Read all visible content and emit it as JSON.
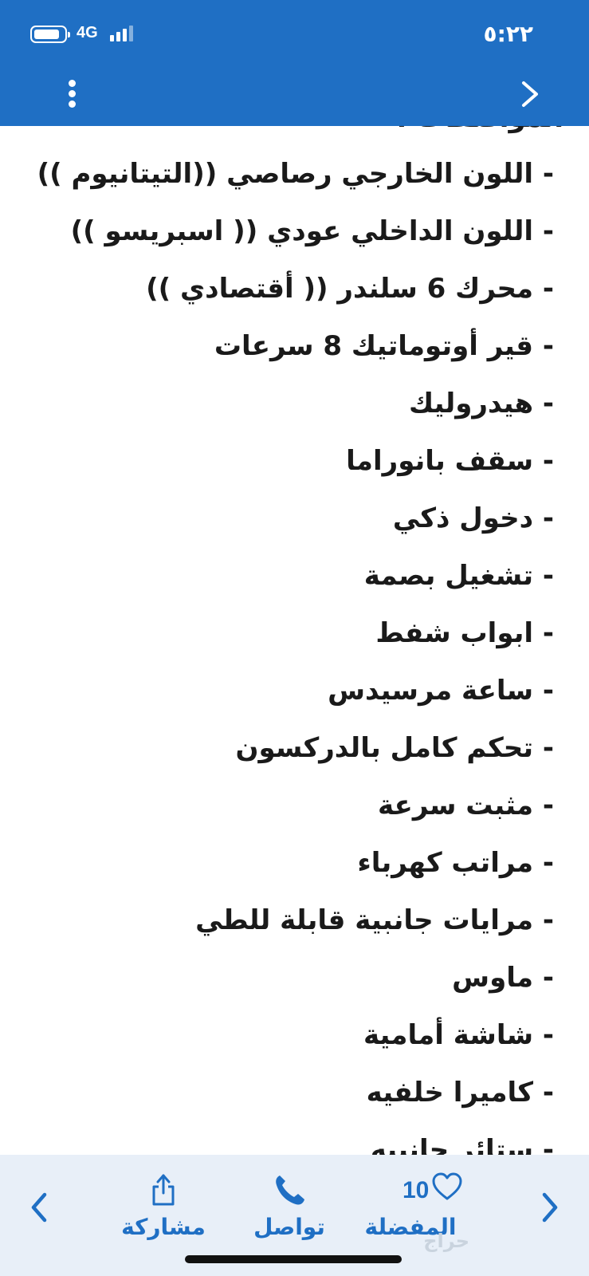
{
  "status_bar": {
    "network": "4G",
    "time": "٥:٢٢",
    "battery_level": 0.85
  },
  "header": {
    "menu_icon": "kebab-menu-icon",
    "back_icon": "chevron-right-icon"
  },
  "content": {
    "partial_title": "المواصفات :",
    "features": [
      "- اللون الخارجي رصاصي ((التيتانيوم ))",
      "- اللون الداخلي عودي (( اسبريسو ))",
      "-  محرك 6 سلندر (( أقتصادي ))",
      "- قير أوتوماتيك 8 سرعات",
      "- هيدروليك",
      "- سقف بانوراما",
      "- دخول ذكي",
      "- تشغيل بصمة",
      "- ابواب شفط",
      "- ساعة مرسيدس",
      "- تحكم كامل بالدركسون",
      "- مثبت سرعة",
      "- مراتب كهرباء",
      "- مرايات جانبية قابلة للطي",
      "- ماوس",
      "- شاشة أمامية",
      "- كاميرا خلفيه",
      "- ستائر جانبيه"
    ]
  },
  "bottom_bar": {
    "prev_icon": "chevron-left-icon",
    "next_icon": "chevron-right-icon",
    "share_label": "مشاركة",
    "contact_label": "تواصل",
    "favorite_label": "المفضلة",
    "favorite_count": "10",
    "watermark": "حراج",
    "accent_color": "#1f6fc4"
  }
}
